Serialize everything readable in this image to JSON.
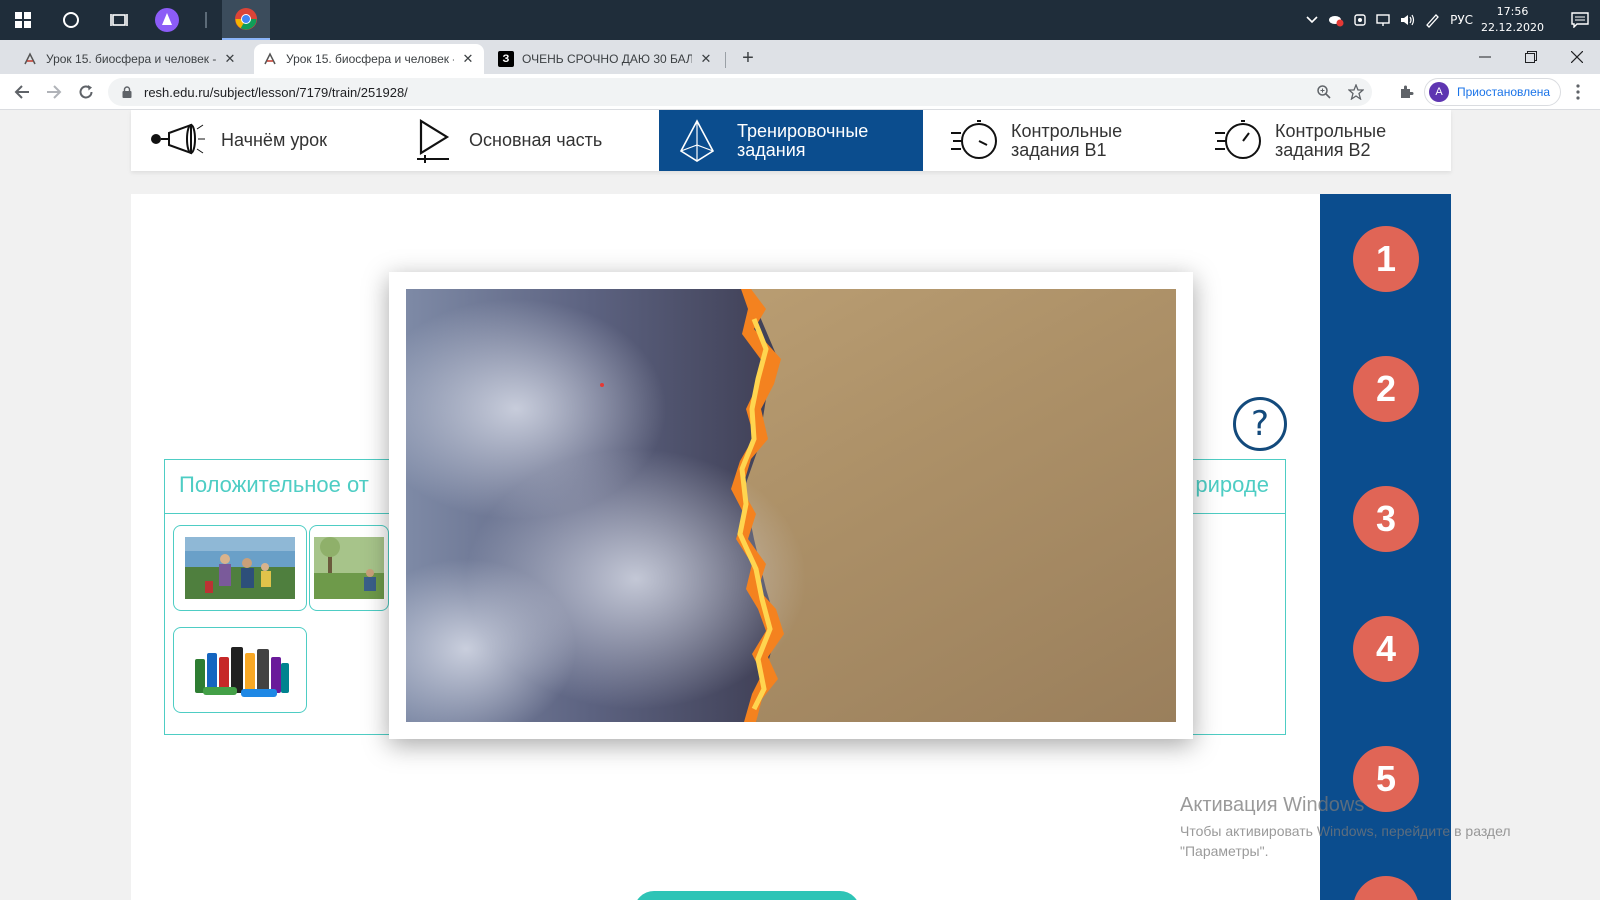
{
  "taskbar": {
    "lang": "РУС",
    "time": "17:56",
    "date": "22.12.2020"
  },
  "tabs": [
    {
      "title": "Урок 15. биосфера и человек - "
    },
    {
      "title": "Урок 15. биосфера и человек - "
    },
    {
      "title": "ОЧЕНЬ СРОЧНО ДАЮ 30 БАЛЛ"
    }
  ],
  "tab_favicon_letter": "З",
  "toolbar": {
    "url": "resh.edu.ru/subject/lesson/7179/train/251928/",
    "profile_initial": "A",
    "profile_label": "Приостановлена"
  },
  "lesson_nav": {
    "items": [
      {
        "label": "Начнём урок"
      },
      {
        "label": "Основная часть"
      },
      {
        "label": "Тренировочные задания"
      },
      {
        "label": "Контрольные задания В1"
      },
      {
        "label": "Контрольные задания В2"
      }
    ],
    "active_index": 2
  },
  "task": {
    "help_symbol": "?",
    "heading_left": "Положительное от",
    "heading_right": "рироде"
  },
  "side_numbers": [
    "1",
    "2",
    "3",
    "4",
    "5"
  ],
  "watermark": {
    "title": "Активация Windows",
    "line1": "Чтобы активировать Windows, перейдите в раздел",
    "line2": "\"Параметры\"."
  },
  "colors": {
    "accent_blue": "#0b4d8e",
    "teal": "#4ecdc4",
    "number_circle": "#e06556"
  }
}
